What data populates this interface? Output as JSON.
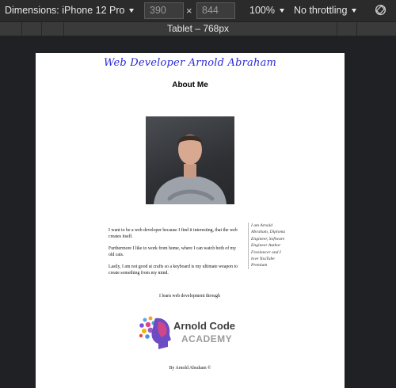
{
  "toolbar": {
    "dimensions_label": "Dimensions: iPhone 12 Pro",
    "width_value": "390",
    "height_value": "844",
    "times": "×",
    "zoom": "100%",
    "throttling": "No throttling",
    "rotate_icon": "rotate-icon"
  },
  "media_query_bar": {
    "label": "Tablet – 768px"
  },
  "page": {
    "logo_text": "Web Developer Arnold Abraham",
    "heading": "About Me",
    "paragraphs": [
      "I want to be a web developer because I find it interesting, that the web creates itself.",
      "Furthermore I like to work from home, where I can watch both of my old cats.",
      "Lastly, I am not good at crafts so a keyboard is my ultimate weapon to create something from my mind."
    ],
    "learn_line": "I learn web development through",
    "aside": "I am Arnold Abraham, Diploma Engineer, Software Engineer Author Freelancer and I love YouTube Premium",
    "academy": {
      "name": "Arnold Code",
      "sub": "ACADEMY"
    },
    "footer": "By Arnold Abraham ©"
  },
  "colors": {
    "logo_text": "#2a2ad8",
    "toolbar_bg": "#2b2b2b",
    "page_bg": "#ffffff"
  }
}
